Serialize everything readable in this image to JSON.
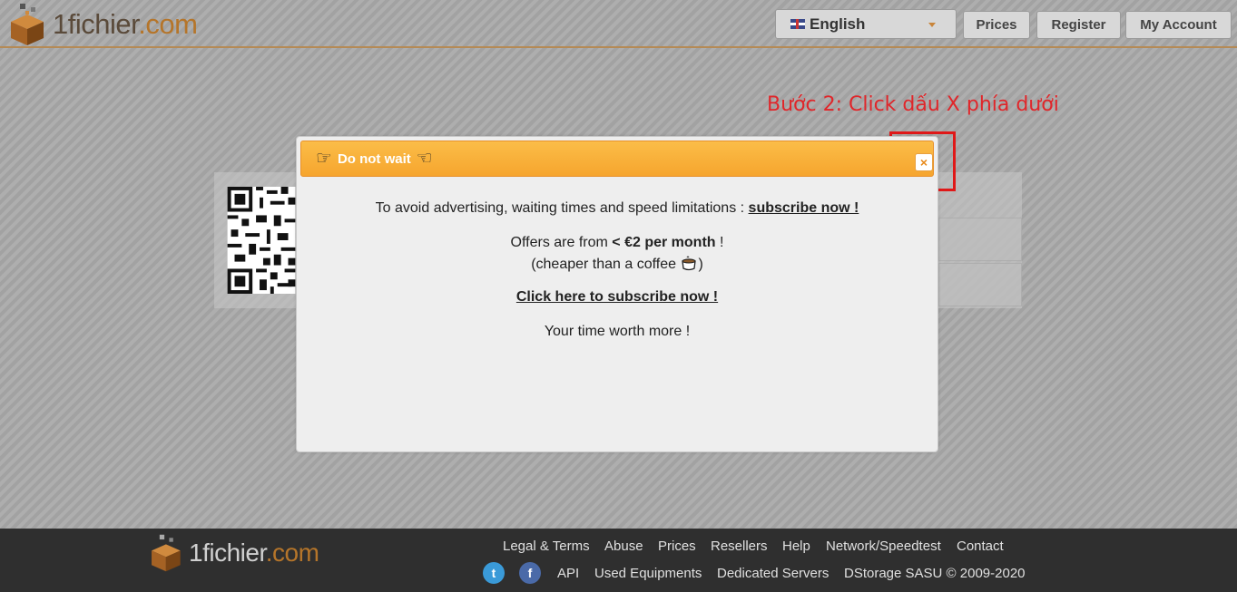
{
  "header": {
    "logo_text_a": "1fichier",
    "logo_text_b": ".com",
    "language": "English",
    "buttons": [
      "Prices",
      "Register",
      "My Account"
    ]
  },
  "annotation": {
    "text": "Bước 2: Click dấu X phía dưới"
  },
  "modal": {
    "title": "Do not wait",
    "close_glyph": "×",
    "line1_text": "To avoid advertising, waiting times and speed limitations :",
    "line1_link": "subscribe now !",
    "line2_text": "Offers are from",
    "line2_bold": "< €2 per month",
    "line2_end": "!",
    "line3": "(cheaper than a coffee",
    "line3_end": ")",
    "line4_link": "Click here to subscribe now !",
    "line5": "Your time worth more !"
  },
  "footer": {
    "logo_text_a": "1fichier",
    "logo_text_b": ".com",
    "links_row1": [
      "Legal & Terms",
      "Abuse",
      "Prices",
      "Resellers",
      "Help",
      "Network/Speedtest",
      "Contact"
    ],
    "links_row2": [
      "API",
      "Used Equipments",
      "Dedicated Servers",
      "DStorage SASU © 2009-2020"
    ],
    "social": [
      "twitter-icon",
      "facebook-icon"
    ]
  },
  "colors": {
    "accent": "#f6a52e",
    "annotation_red": "#e0262a",
    "footer_bg": "#2f2f2f"
  }
}
